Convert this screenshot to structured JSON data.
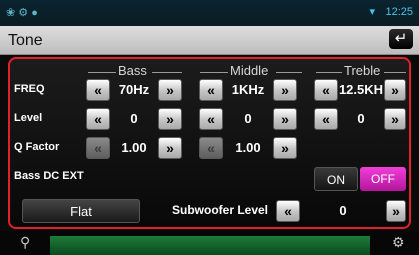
{
  "status": {
    "time": "12:25",
    "left_icons": "❀ ⚙ ●"
  },
  "header": {
    "title": "Tone",
    "back_icon": "↵"
  },
  "columns": [
    "Bass",
    "Middle",
    "Treble"
  ],
  "rows": {
    "freq": {
      "label": "FREQ",
      "bass": "70Hz",
      "middle": "1KHz",
      "treble": "12.5KH"
    },
    "level": {
      "label": "Level",
      "bass": "0",
      "middle": "0",
      "treble": "0"
    },
    "q": {
      "label": "Q Factor",
      "bass": "1.00",
      "middle": "1.00"
    }
  },
  "bass_dc": {
    "label": "Bass DC EXT",
    "on": "ON",
    "off": "OFF"
  },
  "flat_label": "Flat",
  "subwoofer": {
    "label": "Subwoofer Level",
    "value": "0"
  },
  "arrows": {
    "left": "«",
    "right": "»"
  },
  "colors": {
    "accent_red": "#e4202c",
    "off_magenta": "#e12bc8",
    "status_cyan": "#49c3e6"
  }
}
